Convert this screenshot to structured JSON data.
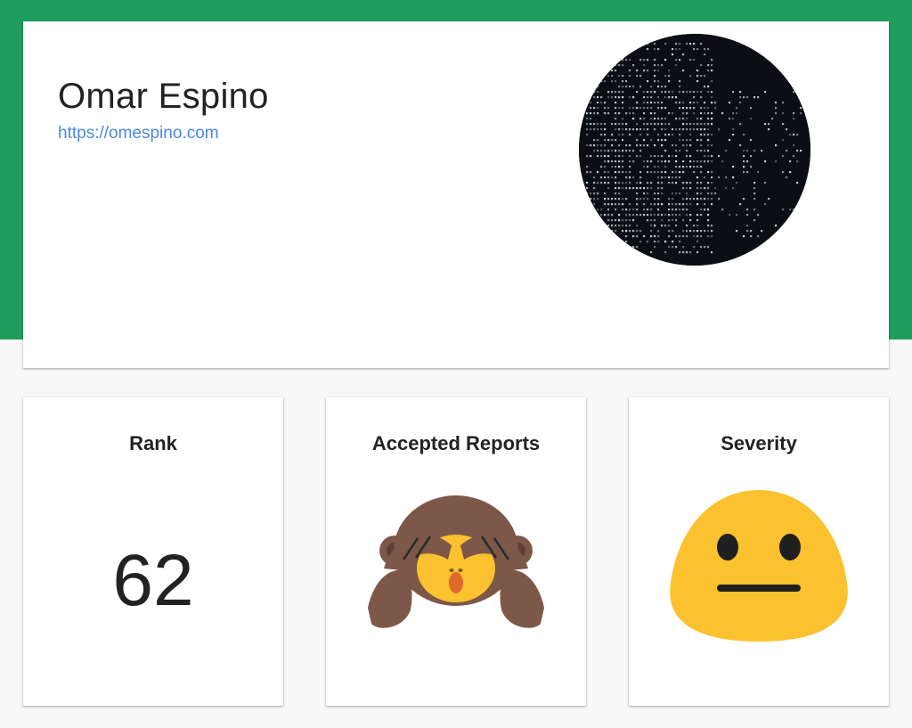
{
  "profile": {
    "name": "Omar Espino",
    "url": "https://omespino.com",
    "avatar_icon": "ascii-art-globe-avatar"
  },
  "stats": {
    "rank": {
      "title": "Rank",
      "value": "62"
    },
    "accepted_reports": {
      "title": "Accepted Reports",
      "icon": "see-no-evil-monkey-icon"
    },
    "severity": {
      "title": "Severity",
      "icon": "neutral-face-icon"
    }
  },
  "colors": {
    "header_band": "#1f9d5c",
    "link": "#4a89dc",
    "monkey_brown": "#7d5848",
    "face_yellow": "#fbc12e",
    "background": "#f8f8f8"
  }
}
